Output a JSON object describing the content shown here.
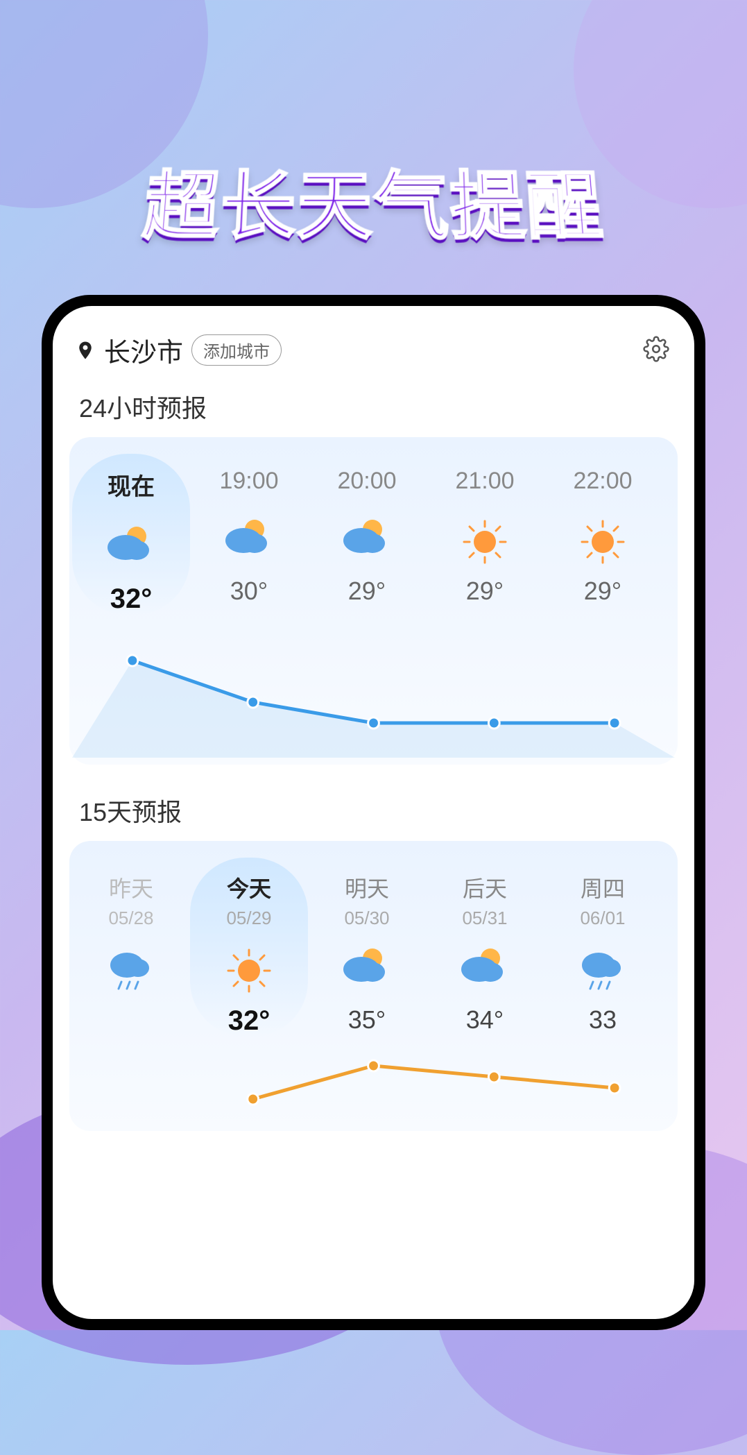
{
  "banner": "超长天气提醒",
  "header": {
    "city": "长沙市",
    "add_city_label": "添加城市"
  },
  "hourly": {
    "title": "24小时预报",
    "items": [
      {
        "time": "现在",
        "icon": "partly_cloudy",
        "temp": "32°"
      },
      {
        "time": "19:00",
        "icon": "partly_cloudy",
        "temp": "30°"
      },
      {
        "time": "20:00",
        "icon": "partly_cloudy",
        "temp": "29°"
      },
      {
        "time": "21:00",
        "icon": "sunny",
        "temp": "29°"
      },
      {
        "time": "22:00",
        "icon": "sunny",
        "temp": "29°"
      }
    ]
  },
  "daily": {
    "title": "15天预报",
    "items": [
      {
        "name": "昨天",
        "date": "05/28",
        "icon": "rain",
        "temp": ""
      },
      {
        "name": "今天",
        "date": "05/29",
        "icon": "sunny",
        "temp": "32°"
      },
      {
        "name": "明天",
        "date": "05/30",
        "icon": "partly_cloudy",
        "temp": "35°"
      },
      {
        "name": "后天",
        "date": "05/31",
        "icon": "partly_cloudy",
        "temp": "34°"
      },
      {
        "name": "周四",
        "date": "06/01",
        "icon": "rain",
        "temp": "33"
      }
    ]
  },
  "chart_data": [
    {
      "type": "line",
      "title": "24小时预报",
      "categories": [
        "现在",
        "19:00",
        "20:00",
        "21:00",
        "22:00"
      ],
      "values": [
        32,
        30,
        29,
        29,
        29
      ],
      "ylabel": "°",
      "ylim": [
        28,
        33
      ],
      "line_color": "#3a9be8"
    },
    {
      "type": "line",
      "title": "15天预报",
      "categories": [
        "昨天",
        "今天",
        "明天",
        "后天",
        "周四"
      ],
      "values": [
        null,
        32,
        35,
        34,
        33
      ],
      "ylabel": "°",
      "ylim": [
        31,
        36
      ],
      "line_color": "#f0a030"
    }
  ],
  "colors": {
    "hourly_line": "#3a9be8",
    "daily_line": "#f0a030"
  }
}
